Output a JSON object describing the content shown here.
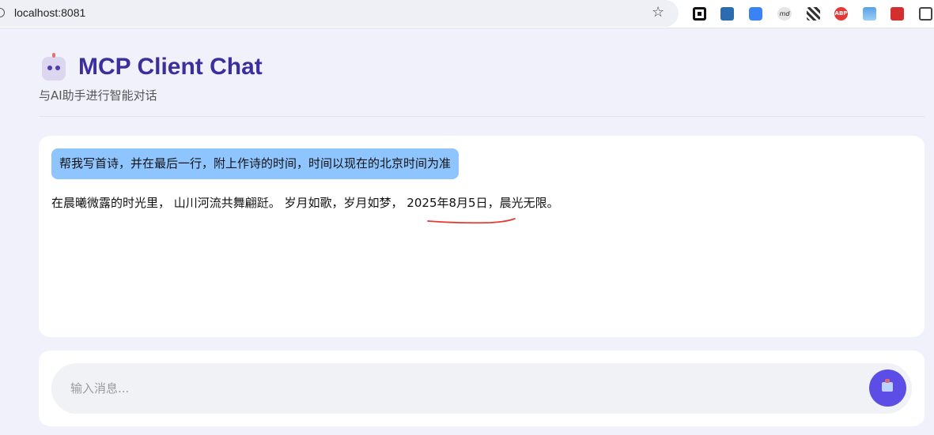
{
  "browser": {
    "url": "localhost:8081"
  },
  "header": {
    "title": "MCP Client Chat",
    "subtitle": "与AI助手进行智能对话"
  },
  "chat": {
    "messages": [
      {
        "role": "user",
        "text": "帮我写首诗，并在最后一行，附上作诗的时间，时间以现在的北京时间为准"
      },
      {
        "role": "assistant",
        "text": "在晨曦微露的时光里， 山川河流共舞翩跹。 岁月如歌，岁月如梦， 2025年8月5日，晨光无限。"
      }
    ]
  },
  "composer": {
    "placeholder": "输入消息...",
    "value": ""
  },
  "colors": {
    "accent": "#5b4de6",
    "title": "#3b2f9e",
    "user_bubble": "#8ec5ff",
    "annotation": "#e53935"
  }
}
